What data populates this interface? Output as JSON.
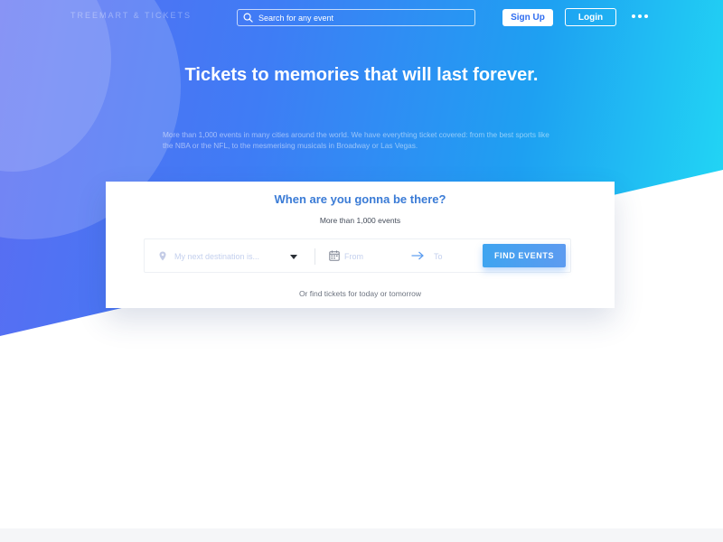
{
  "nav": {
    "logo_text": "TREEMART & TICKETS",
    "search_placeholder": "Search for any event",
    "signup_label": "Sign Up",
    "login_label": "Login"
  },
  "hero": {
    "headline": "Tickets to memories that will last forever.",
    "description": "More than 1,000 events in many cities around the world. We have everything ticket covered: from the best sports like the NBA or the NFL, to the mesmerising musicals in Broadway or Las Vegas."
  },
  "card": {
    "title": "When are you gonna be there?",
    "subtitle": "More than 1,000 events",
    "destination_placeholder": "My next destination is...",
    "from_placeholder": "From",
    "to_placeholder": "To",
    "find_button": "FIND EVENTS",
    "footer": "Or find tickets for today or tomorrow"
  },
  "icons": {
    "search": "search-icon",
    "more": "more-dots-icon",
    "pin": "map-pin-icon",
    "dropdown": "caret-down-icon",
    "calendar": "calendar-icon",
    "arrow": "arrow-right-icon"
  },
  "colors": {
    "accent": "#3a7bd6",
    "button": "#3ea4f0",
    "gradient_start": "#5b6cf2",
    "gradient_end": "#22dcf4"
  }
}
